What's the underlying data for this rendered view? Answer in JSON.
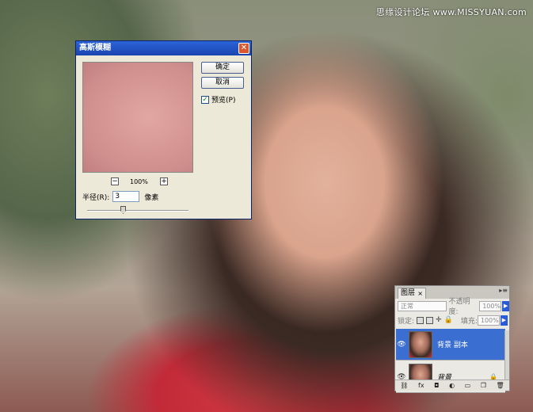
{
  "watermark": "思缘设计论坛 www.MISSYUAN.com",
  "gaussian_dialog": {
    "title": "高斯模糊",
    "ok_label": "确定",
    "cancel_label": "取消",
    "preview_label": "预览(P)",
    "preview_checked": true,
    "zoom_out": "−",
    "zoom_in": "+",
    "zoom_level": "100%",
    "radius_label": "半径(R):",
    "radius_value": "3",
    "radius_unit": "像素"
  },
  "layers_panel": {
    "tab_label": "图层",
    "tab_close": "×",
    "blend_mode": "正常",
    "opacity_label": "不透明度:",
    "opacity_value": "100%",
    "lock_label": "锁定:",
    "fill_label": "填充:",
    "fill_value": "100%",
    "layers": [
      {
        "name": "背景 副本",
        "selected": true
      },
      {
        "name": "背景",
        "selected": false
      }
    ],
    "icons": [
      "link-icon",
      "fx-icon",
      "mask-icon",
      "adjustment-icon",
      "group-icon",
      "new-layer-icon",
      "trash-icon"
    ]
  },
  "colors": {
    "title_blue": "#2c64d8",
    "selected_layer": "#3a6ed1"
  }
}
